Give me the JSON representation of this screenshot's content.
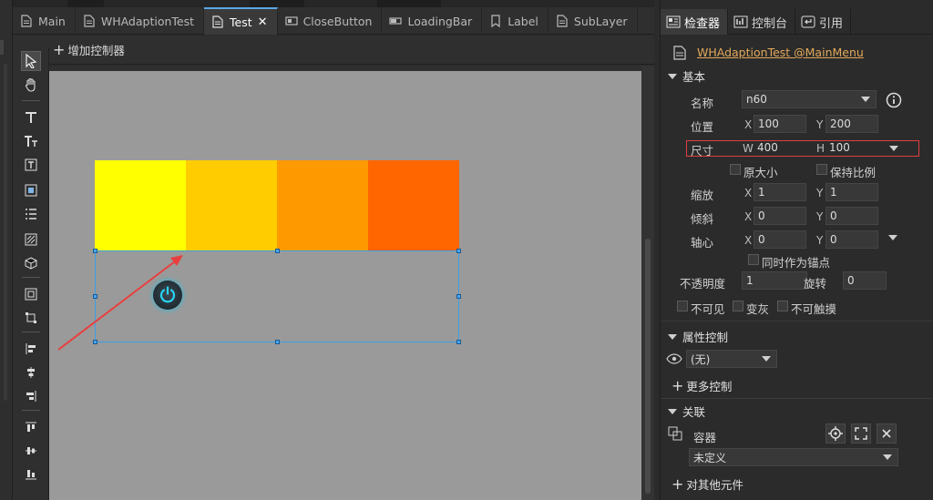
{
  "tabs": [
    {
      "label": "Main",
      "icon": "document-icon"
    },
    {
      "label": "WHAdaptionTest",
      "icon": "document-icon"
    },
    {
      "label": "Test",
      "icon": "document-icon",
      "active": true
    },
    {
      "label": "CloseButton",
      "icon": "component-icon"
    },
    {
      "label": "LoadingBar",
      "icon": "component-icon"
    },
    {
      "label": "Label",
      "icon": "label-icon"
    },
    {
      "label": "SubLayer",
      "icon": "document-icon"
    }
  ],
  "toolbar": {
    "add_controller_label": "增加控制器"
  },
  "canvas": {
    "bar_colors": [
      "#ffff00",
      "#ffcc00",
      "#ff9900",
      "#ff6600"
    ],
    "button_icon": "power-icon",
    "annotation_color": "#e84040"
  },
  "panel": {
    "tabs": [
      {
        "label": "检查器",
        "icon": "inspector-icon",
        "active": true
      },
      {
        "label": "控制台",
        "icon": "console-icon"
      },
      {
        "label": "引用",
        "icon": "reference-icon"
      }
    ],
    "component_link": "WHAdaptionTest @MainMenu",
    "basic": {
      "section_label": "基本",
      "name_label": "名称",
      "name_value": "n60",
      "position_label": "位置",
      "x_label": "X",
      "y_label": "Y",
      "pos_x": "100",
      "pos_y": "200",
      "size_label": "尺寸",
      "w_label": "W",
      "h_label": "H",
      "size_w": "400",
      "size_h": "100",
      "original_size_label": "原大小",
      "keep_ratio_label": "保持比例",
      "scale_label": "缩放",
      "scale_x": "1",
      "scale_y": "1",
      "skew_label": "倾斜",
      "skew_x": "0",
      "skew_y": "0",
      "pivot_label": "轴心",
      "pivot_x": "0",
      "pivot_y": "0",
      "as_anchor_label": "同时作为锚点",
      "opacity_label": "不透明度",
      "opacity_value": "1",
      "rotation_label": "旋转",
      "rotation_value": "0",
      "invisible_label": "不可见",
      "grayed_label": "变灰",
      "untouchable_label": "不可触摸"
    },
    "property_control": {
      "section_label": "属性控制",
      "visible_value": "(无)",
      "more_label": "更多控制"
    },
    "relation": {
      "section_label": "关联",
      "container_label": "容器",
      "container_value": "未定义",
      "other_label": "对其他元件"
    }
  }
}
